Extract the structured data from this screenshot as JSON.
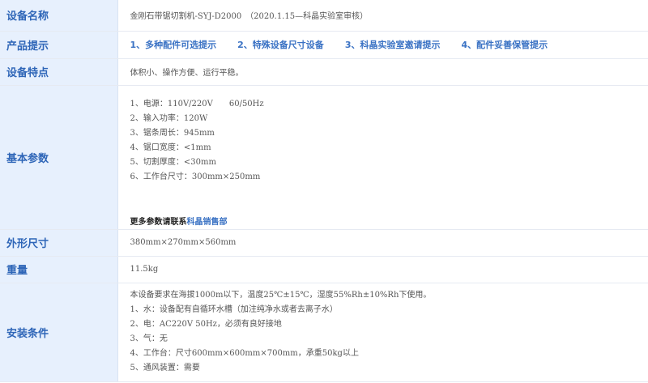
{
  "rows": {
    "name": {
      "label": "设备名称",
      "value": "金刚石带锯切割机-SYJ-D2000　（2020.1.15—科晶实验室审核）"
    },
    "tips": {
      "label": "产品提示",
      "links": [
        "1、多种配件可选提示",
        "2、特殊设备尺寸设备",
        "3、科晶实验室邀请提示",
        "4、配件妥善保管提示"
      ]
    },
    "features": {
      "label": "设备特点",
      "value": "体积小、操作方便、运行平稳。"
    },
    "params": {
      "label": "基本参数",
      "lines": [
        "1、电源：110V/220V　　60/50Hz",
        "2、输入功率：120W",
        "3、锯条周长：945mm",
        "4、锯口宽度：<1mm",
        "5、切割厚度：<30mm",
        "6、工作台尺寸：300mm×250mm"
      ],
      "more_text": "更多参数请联系",
      "more_link": "科晶销售部"
    },
    "size": {
      "label": "外形尺寸",
      "value": "380mm×270mm×560mm"
    },
    "weight": {
      "label": "重量",
      "value": "11.5kg"
    },
    "install": {
      "label": "安装条件",
      "lines": [
        "本设备要求在海拔1000m以下，温度25℃±15℃，湿度55%Rh±10%Rh下使用。",
        "1、水：设备配有自循环水槽（加注纯净水或者去离子水）",
        "2、电：AC220V 50Hz，必须有良好接地",
        "3、气：无",
        "4、工作台：尺寸600mm×600mm×700mm，承重50kg以上",
        "5、通风装置：需要"
      ]
    }
  }
}
